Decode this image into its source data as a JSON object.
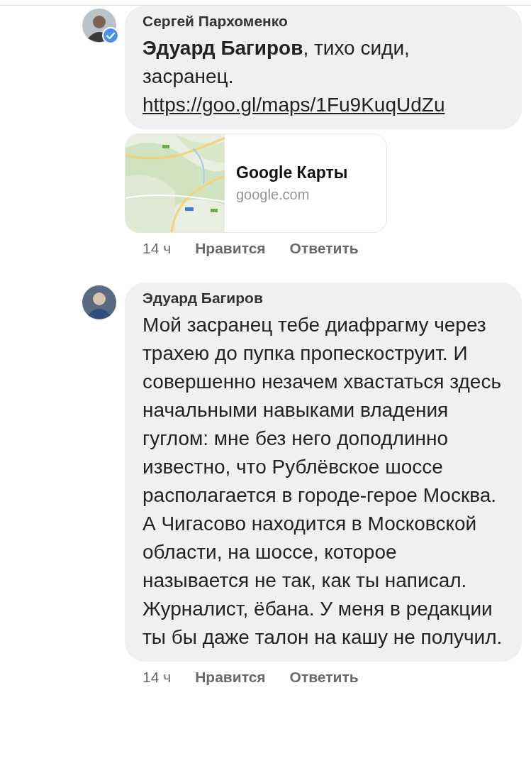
{
  "comments": [
    {
      "author": "Сергей Пархоменко",
      "verified": true,
      "text": "**Эдуард Багиров**, тихо сиди, засранец.",
      "link": "https://goo.gl/maps/1Fu9KuqUdZu",
      "preview": {
        "kind": "picture",
        "title": "Google Карты",
        "domain": "google.com"
      },
      "time": "14 ч",
      "actions": [
        "Нравится",
        "Ответить"
      ]
    },
    {
      "author": "Эдуард Багиров",
      "verified": false,
      "text": "Мой засранец тебе диафрагму через трахею до пупка пропескоструит. И совершенно незачем хвастаться здесь начальными навыками владения гуглом: мне без него доподлинно известно, что Рублёвское шоссе располагается в городе-герое Москва. А Чигасово находится в Московской области, на шоссе, которое называется не так, как ты написал. Журналист, ёбана. У меня в редакции ты бы даже талон на кашу не получил.",
      "time": "14 ч",
      "actions": [
        "Нравится",
        "Ответить"
      ]
    }
  ]
}
